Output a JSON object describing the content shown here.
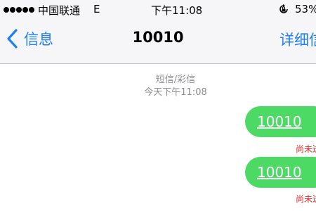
{
  "status_bar": {
    "carrier": "中国联通",
    "network": "E",
    "time": "下午11:08",
    "battery": "53%",
    "icons": {
      "signal": "signal-dots-icon",
      "rotation_lock": "rotation-lock-icon"
    }
  },
  "nav": {
    "back_label": "信息",
    "title": "10010",
    "details_label": "详细信息"
  },
  "thread": {
    "message_type": "短信/彩信",
    "timestamp": "今天下午11:08",
    "messages": [
      {
        "text": "10010",
        "status": "尚未送达"
      },
      {
        "text": "10010",
        "status": "尚未送达"
      }
    ]
  },
  "colors": {
    "accent": "#1f7ff0",
    "bubble": "#4cd964",
    "error": "#e02b2b",
    "meta": "#8e8e93"
  }
}
